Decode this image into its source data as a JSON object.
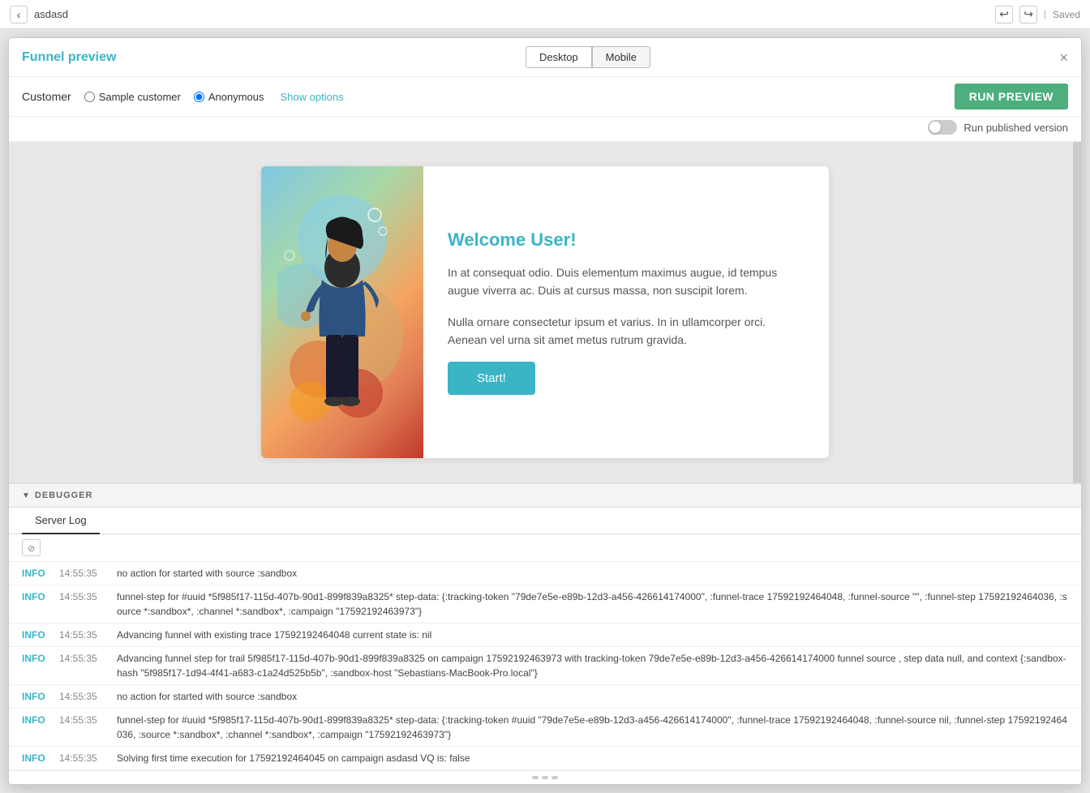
{
  "topbar": {
    "back_label": "‹",
    "breadcrumb": "asdasd",
    "undo_icon": "↩",
    "redo_icon": "↪",
    "saved_label": "Saved"
  },
  "modal": {
    "title": "Funnel preview",
    "close_icon": "×",
    "view_toggle": {
      "desktop_label": "Desktop",
      "mobile_label": "Mobile"
    },
    "customer_label": "Customer",
    "sample_customer_label": "Sample customer",
    "anonymous_label": "Anonymous",
    "show_options_label": "Show options",
    "run_preview_label": "RUN PREVIEW",
    "run_published_label": "Run published version"
  },
  "funnel_card": {
    "title": "Welcome User!",
    "paragraph1": "In at consequat odio. Duis elementum maximus augue, id tempus augue viverra ac. Duis at cursus massa, non suscipit lorem.",
    "paragraph2": "Nulla ornare consectetur ipsum et varius. In in ullamcorper orci. Aenean vel urna sit amet metus rutrum gravida.",
    "start_button": "Start!"
  },
  "debugger": {
    "header_label": "DEBUGGER",
    "tab_server_log": "Server Log"
  },
  "log_entries": [
    {
      "level": "INFO",
      "time": "14:55:35",
      "message": "no action for started with source :sandbox"
    },
    {
      "level": "INFO",
      "time": "14:55:35",
      "message": "funnel-step for #uuid *5f985f17-115d-407b-90d1-899f839a8325* step-data: {:tracking-token \"79de7e5e-e89b-12d3-a456-426614174000\", :funnel-trace 17592192464048, :funnel-source \"\", :funnel-step 17592192464036, :source *:sandbox*, :channel *:sandbox*, :campaign \"17592192463973\"}"
    },
    {
      "level": "INFO",
      "time": "14:55:35",
      "message": "Advancing funnel with existing trace 17592192464048 current state is: nil"
    },
    {
      "level": "INFO",
      "time": "14:55:35",
      "message": "Advancing funnel step for trail 5f985f17-115d-407b-90d1-899f839a8325 on campaign 17592192463973 with tracking-token 79de7e5e-e89b-12d3-a456-426614174000 funnel source , step data null, and context {:sandbox-hash \"5f985f17-1d94-4f41-a683-c1a24d525b5b\", :sandbox-host \"Sebastians-MacBook-Pro.local\"}"
    },
    {
      "level": "INFO",
      "time": "14:55:35",
      "message": "no action for started with source :sandbox"
    },
    {
      "level": "INFO",
      "time": "14:55:35",
      "message": "funnel-step for #uuid *5f985f17-115d-407b-90d1-899f839a8325* step-data: {:tracking-token #uuid \"79de7e5e-e89b-12d3-a456-426614174000\", :funnel-trace 17592192464048, :funnel-source nil, :funnel-step 17592192464036, :source *:sandbox*, :channel *:sandbox*, :campaign \"17592192463973\"}"
    },
    {
      "level": "INFO",
      "time": "14:55:35",
      "message": "Solving first time execution for 17592192464045 on campaign asdasd VQ is: false"
    }
  ],
  "colors": {
    "teal": "#3ab5c6",
    "green": "#4caf7d"
  }
}
